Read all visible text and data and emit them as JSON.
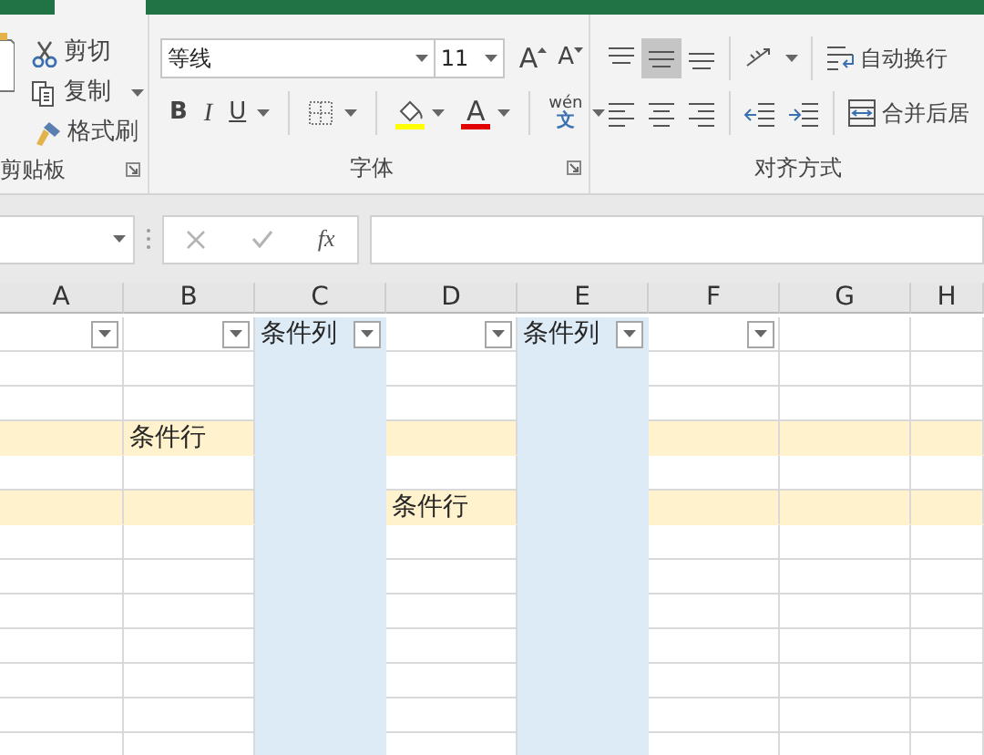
{
  "ribbon": {
    "clipboard": {
      "items": [
        {
          "kind": "cut",
          "label": "剪切",
          "dropdown": false
        },
        {
          "kind": "copy",
          "label": "复制",
          "dropdown": true
        },
        {
          "kind": "painter",
          "label": "格式刷",
          "dropdown": false
        }
      ],
      "label": "剪贴板"
    },
    "font": {
      "font_name": "等线",
      "font_size": "11",
      "grow": "A",
      "shrink": "A",
      "bold": "B",
      "italic": "I",
      "underline": "U",
      "font_color_letter": "A",
      "phonetic_pinyin": "wén",
      "phonetic_char": "文",
      "label": "字体"
    },
    "alignment": {
      "vertical": [
        {
          "kind": "top",
          "selected": false
        },
        {
          "kind": "middle",
          "selected": true
        },
        {
          "kind": "bottom",
          "selected": false
        }
      ],
      "horizontal": [
        {
          "kind": "left",
          "selected": false
        },
        {
          "kind": "center",
          "selected": false
        },
        {
          "kind": "right",
          "selected": false
        }
      ],
      "wrap_text": "自动换行",
      "merge": "合并后居",
      "label": "对齐方式"
    }
  },
  "formula_bar": {
    "function_label": "fx"
  },
  "sheet": {
    "columns": [
      {
        "header": "A",
        "filter": true,
        "highlighted": false
      },
      {
        "header": "B",
        "filter": true,
        "highlighted": false
      },
      {
        "header": "C",
        "filter": true,
        "highlighted": true,
        "filter_label": "条件列"
      },
      {
        "header": "D",
        "filter": true,
        "highlighted": false
      },
      {
        "header": "E",
        "filter": true,
        "highlighted": true,
        "filter_label": "条件列"
      },
      {
        "header": "F",
        "filter": true,
        "highlighted": false
      },
      {
        "header": "G",
        "filter": false,
        "highlighted": false
      },
      {
        "header": "H",
        "filter": false,
        "highlighted": false
      }
    ],
    "rows": [
      {
        "highlighted": false
      },
      {
        "highlighted": false
      },
      {
        "highlighted": true,
        "cells": [
          {},
          {
            "text": "条件行"
          }
        ]
      },
      {
        "highlighted": false
      },
      {
        "highlighted": true,
        "cells": [
          {},
          {},
          {},
          {
            "text": "条件行"
          }
        ]
      },
      {
        "highlighted": false
      },
      {
        "highlighted": false
      },
      {
        "highlighted": false
      },
      {
        "highlighted": false
      },
      {
        "highlighted": false
      },
      {
        "highlighted": false
      },
      {
        "highlighted": false
      }
    ]
  }
}
